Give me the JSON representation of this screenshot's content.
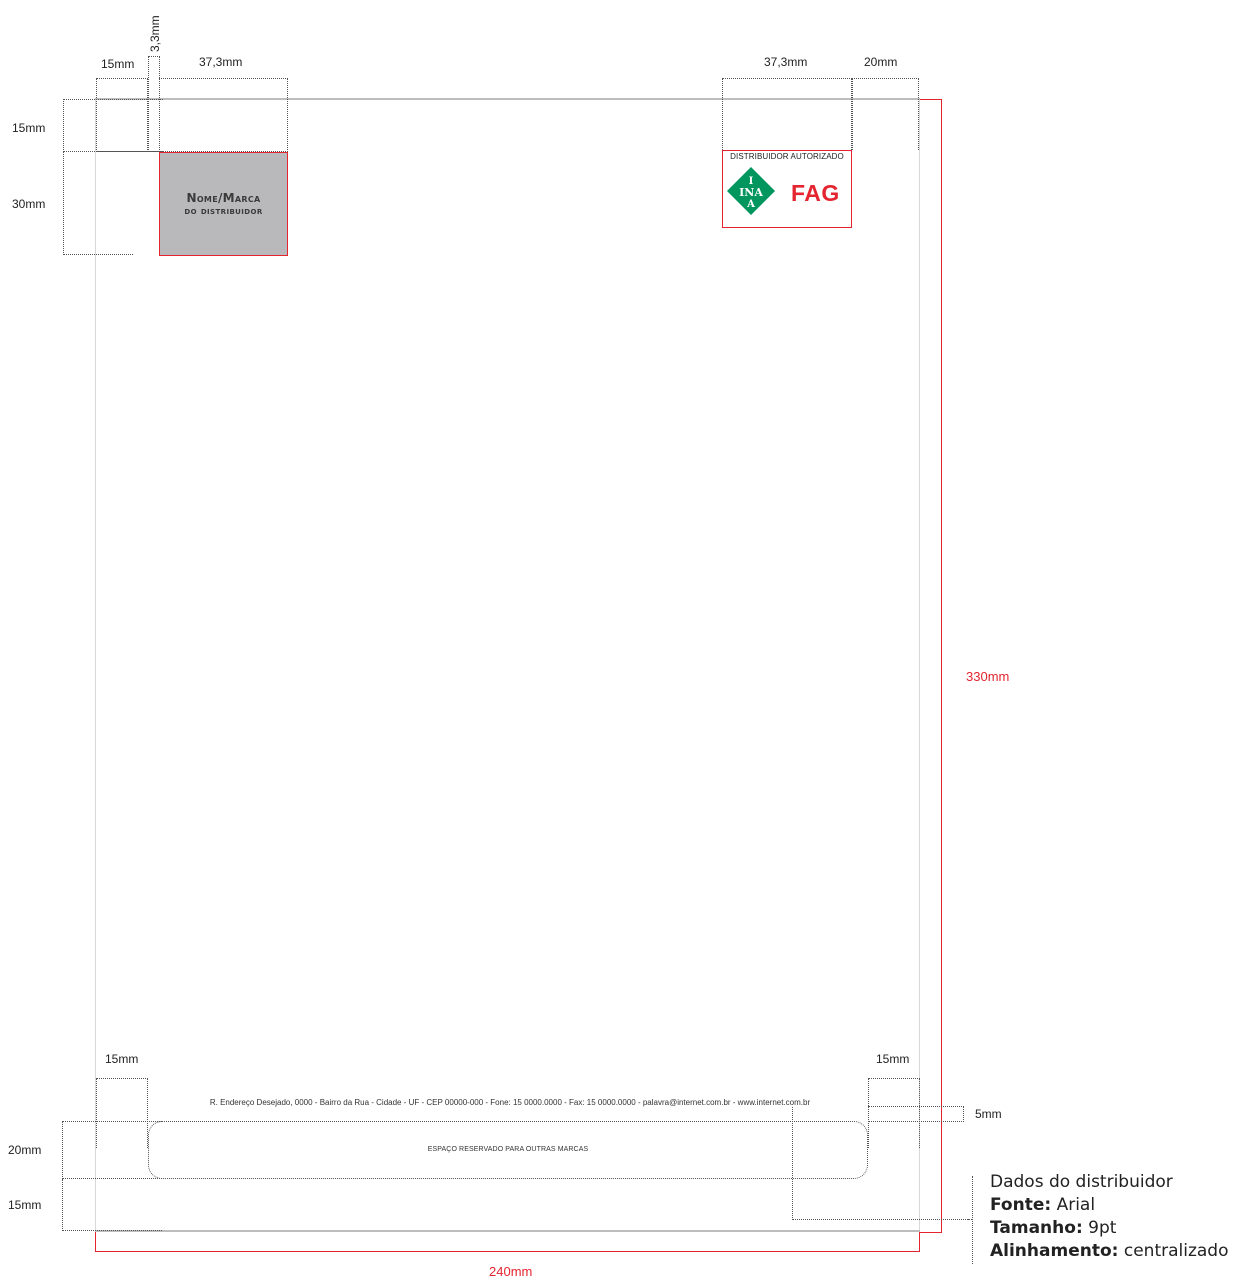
{
  "dimensions": {
    "top_left_margin": "15mm",
    "top_gap": "3,3mm",
    "top_left_logo_width": "37,3mm",
    "top_right_logo_width": "37,3mm",
    "top_right_margin": "20mm",
    "left_top_height": "15mm",
    "left_logo_height": "30mm",
    "sheet_height": "330mm",
    "sheet_width": "240mm",
    "bottom_left_margin": "15mm",
    "bottom_right_margin": "15mm",
    "bottom_gap": "5mm",
    "bottom_reserved_height": "20mm",
    "bottom_margin_height": "15mm"
  },
  "brand_placeholder": {
    "line1": "Nome/Marca",
    "line2": "do distribuidor"
  },
  "authorized": {
    "label": "DISTRIBUIDOR AUTORIZADO",
    "ina_letters": [
      "I",
      "INA",
      "A"
    ],
    "fag": "FAG"
  },
  "footer": {
    "address": "R. Endereço Desejado, 0000 - Bairro da Rua - Cidade - UF - CEP 00000-000 - Fone: 15 0000.0000 - Fax: 15  0000.0000 - palavra@internet.com.br - www.internet.com.br",
    "reserved": "ESPAÇO RESERVADO PARA OUTRAS MARCAS"
  },
  "specs": {
    "title": "Dados do distribuidor",
    "font_label": "Fonte:",
    "font_value": "Arial",
    "size_label": "Tamanho:",
    "size_value": "9pt",
    "align_label": "Alinhamento:",
    "align_value": "centralizado"
  },
  "colors": {
    "accent_red": "#e4252f",
    "ina_green": "#00965e",
    "fag_red": "#e4252f",
    "placeholder_gray": "#b9b9bb"
  }
}
